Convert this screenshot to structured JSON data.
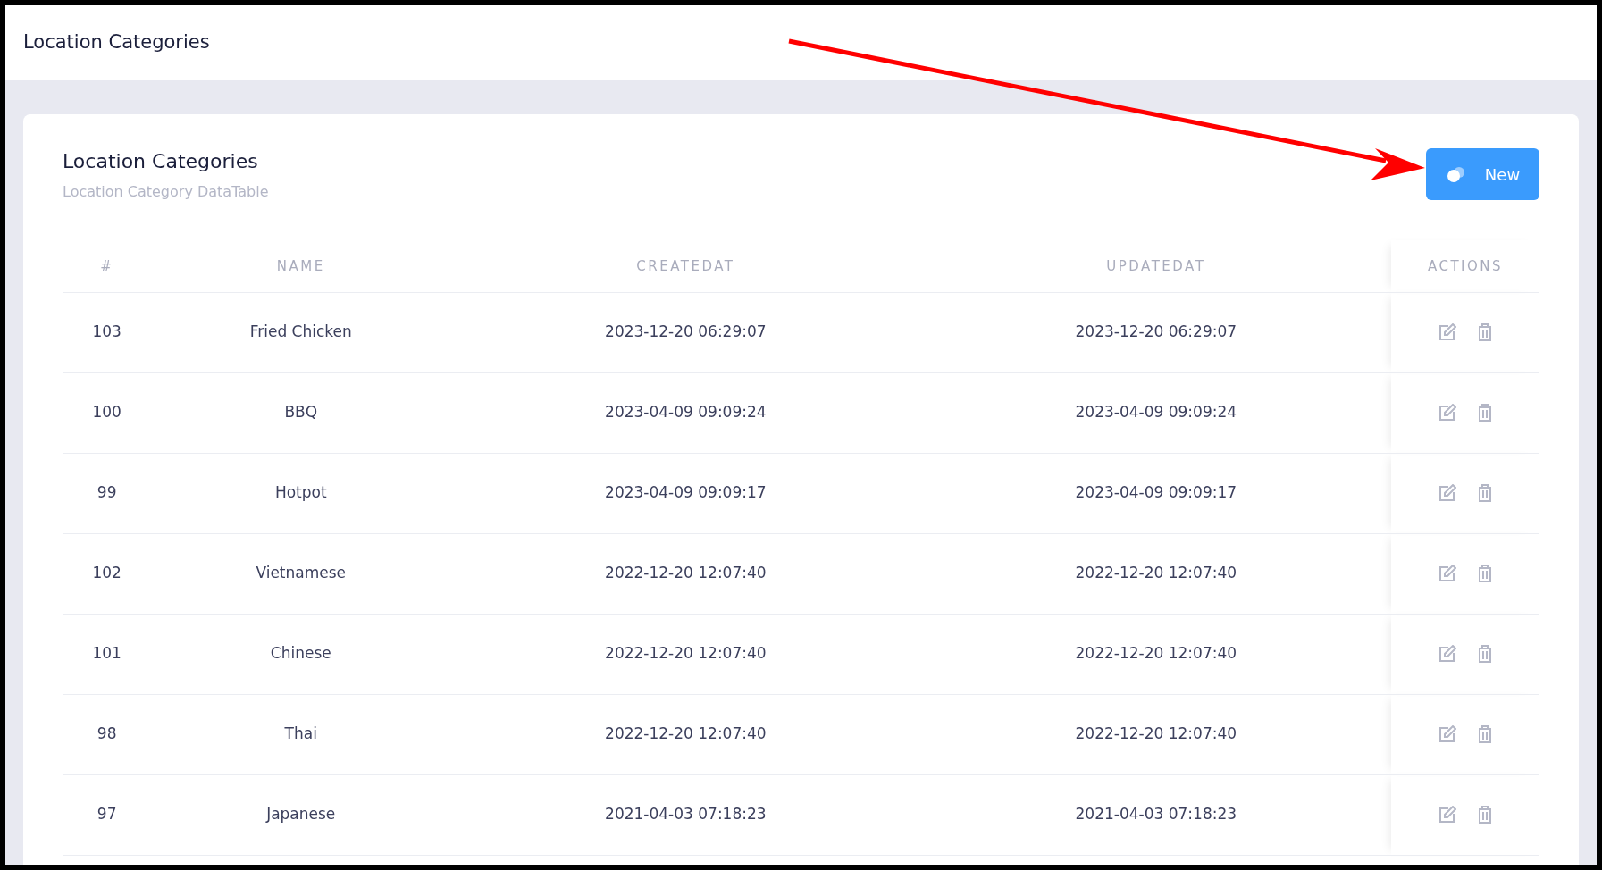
{
  "header": {
    "title": "Location Categories"
  },
  "card": {
    "title": "Location Categories",
    "subtitle": "Location Category DataTable",
    "new_button": "New"
  },
  "table": {
    "columns": [
      "#",
      "NAME",
      "CREATEDAT",
      "UPDATEDAT",
      "ACTIONS"
    ],
    "rows": [
      {
        "id": "103",
        "name": "Fried Chicken",
        "created": "2023-12-20 06:29:07",
        "updated": "2023-12-20 06:29:07"
      },
      {
        "id": "100",
        "name": "BBQ",
        "created": "2023-04-09 09:09:24",
        "updated": "2023-04-09 09:09:24"
      },
      {
        "id": "99",
        "name": "Hotpot",
        "created": "2023-04-09 09:09:17",
        "updated": "2023-04-09 09:09:17"
      },
      {
        "id": "102",
        "name": "Vietnamese",
        "created": "2022-12-20 12:07:40",
        "updated": "2022-12-20 12:07:40"
      },
      {
        "id": "101",
        "name": "Chinese",
        "created": "2022-12-20 12:07:40",
        "updated": "2022-12-20 12:07:40"
      },
      {
        "id": "98",
        "name": "Thai",
        "created": "2022-12-20 12:07:40",
        "updated": "2022-12-20 12:07:40"
      },
      {
        "id": "97",
        "name": "Japanese",
        "created": "2021-04-03 07:18:23",
        "updated": "2021-04-03 07:18:23"
      }
    ]
  }
}
